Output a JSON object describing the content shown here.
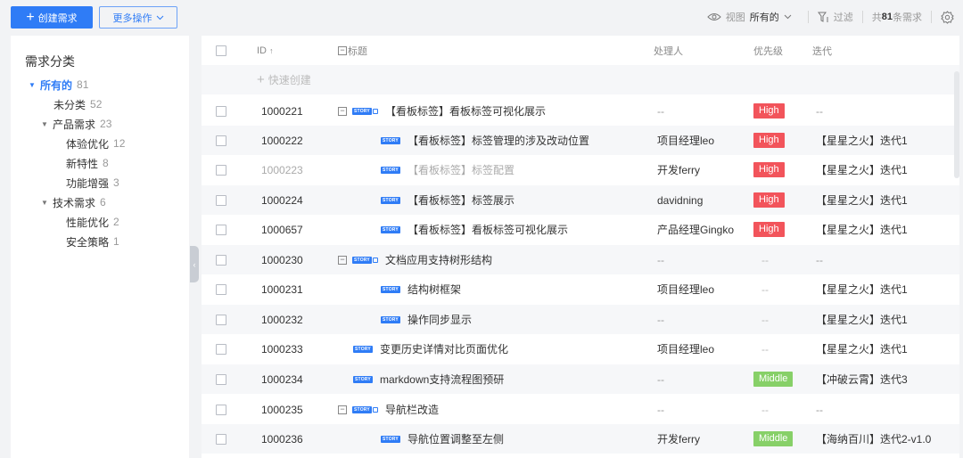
{
  "toolbar": {
    "create_label": "创建需求",
    "more_label": "更多操作",
    "view_label": "视图",
    "view_value": "所有的",
    "filter_label": "过滤",
    "total_prefix": "共",
    "total_count": "81",
    "total_suffix": "条需求"
  },
  "sidebar": {
    "title": "需求分类",
    "nodes": [
      {
        "label": "所有的",
        "count": "81"
      },
      {
        "label": "未分类",
        "count": "52"
      },
      {
        "label": "产品需求",
        "count": "23"
      },
      {
        "label": "体验优化",
        "count": "12"
      },
      {
        "label": "新特性",
        "count": "8"
      },
      {
        "label": "功能增强",
        "count": "3"
      },
      {
        "label": "技术需求",
        "count": "6"
      },
      {
        "label": "性能优化",
        "count": "2"
      },
      {
        "label": "安全策略",
        "count": "1"
      }
    ]
  },
  "table": {
    "headers": {
      "id": "ID",
      "id_sort": "↑",
      "title": "标题",
      "owner": "处理人",
      "priority": "优先级",
      "iteration": "迭代"
    },
    "quick_create": "快速创建",
    "story_tag": "STORY",
    "rows": [
      {
        "id": "1000221",
        "title": "【看板标签】看板标签可视化展示",
        "owner": "--",
        "priority": "High",
        "iteration": "--"
      },
      {
        "id": "1000222",
        "title": "【看板标签】标签管理的涉及改动位置",
        "owner": "项目经理leo",
        "priority": "High",
        "iteration": "【星星之火】迭代1"
      },
      {
        "id": "1000223",
        "title": "【看板标签】标签配置",
        "owner": "开发ferry",
        "priority": "High",
        "iteration": "【星星之火】迭代1"
      },
      {
        "id": "1000224",
        "title": "【看板标签】标签展示",
        "owner": "davidning",
        "priority": "High",
        "iteration": "【星星之火】迭代1"
      },
      {
        "id": "1000657",
        "title": "【看板标签】看板标签可视化展示",
        "owner": "产品经理Gingko",
        "priority": "High",
        "iteration": "【星星之火】迭代1"
      },
      {
        "id": "1000230",
        "title": "文档应用支持树形结构",
        "owner": "--",
        "priority": "--",
        "iteration": "--"
      },
      {
        "id": "1000231",
        "title": "结构树框架",
        "owner": "项目经理leo",
        "priority": "--",
        "iteration": "【星星之火】迭代1"
      },
      {
        "id": "1000232",
        "title": "操作同步显示",
        "owner": "--",
        "priority": "--",
        "iteration": "【星星之火】迭代1"
      },
      {
        "id": "1000233",
        "title": "变更历史详情对比页面优化",
        "owner": "项目经理leo",
        "priority": "--",
        "iteration": "【星星之火】迭代1"
      },
      {
        "id": "1000234",
        "title": "markdown支持流程图预研",
        "owner": "--",
        "priority": "Middle",
        "iteration": "【冲破云霄】迭代3"
      },
      {
        "id": "1000235",
        "title": "导航栏改造",
        "owner": "--",
        "priority": "--",
        "iteration": "--"
      },
      {
        "id": "1000236",
        "title": "导航位置调整至左侧",
        "owner": "开发ferry",
        "priority": "Middle",
        "iteration": "【海纳百川】迭代2-v1.0"
      }
    ]
  },
  "colors": {
    "primary": "#2f7cf6",
    "high": "#f2545b",
    "middle": "#87d068"
  }
}
